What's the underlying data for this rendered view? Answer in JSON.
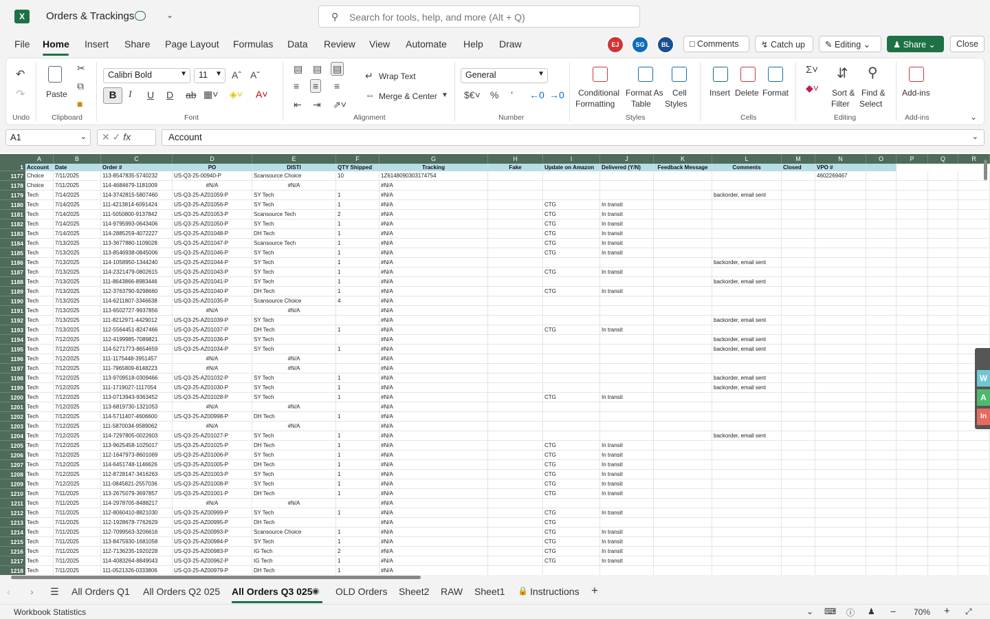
{
  "app": {
    "title": "Orders & Trackings",
    "logo_letter": "X",
    "search_placeholder": "Search for tools, help, and more (Alt + Q)"
  },
  "menu": [
    "File",
    "Home",
    "Insert",
    "Share",
    "Page Layout",
    "Formulas",
    "Data",
    "Review",
    "View",
    "Automate",
    "Help",
    "Draw"
  ],
  "avatars": [
    {
      "initials": "EJ",
      "color": "#d13438"
    },
    {
      "initials": "SG",
      "color": "#0f6cbd"
    },
    {
      "initials": "BL",
      "color": "#1b4f91"
    }
  ],
  "top_buttons": {
    "comments": "Comments",
    "catch_up": "Catch up",
    "editing": "Editing",
    "share": "Share",
    "close": "Close"
  },
  "ribbon": {
    "undo_label": "Undo",
    "paste": "Paste",
    "clipboard": "Clipboard",
    "font_name": "Calibri Bold",
    "font_size": "11",
    "font": "Font",
    "wrap_text": "Wrap Text",
    "merge_center": "Merge & Center",
    "alignment": "Alignment",
    "number_format": "General",
    "number": "Number",
    "cond_format_1": "Conditional",
    "cond_format_2": "Formatting",
    "format_table_1": "Format As",
    "format_table_2": "Table",
    "cell_styles_1": "Cell",
    "cell_styles_2": "Styles",
    "styles": "Styles",
    "insert": "Insert",
    "delete": "Delete",
    "format": "Format",
    "cells": "Cells",
    "sort_1": "Sort &",
    "sort_2": "Filter",
    "find_1": "Find &",
    "find_2": "Select",
    "editing": "Editing",
    "addins_1": "Add-ins",
    "addins_2": "Add-ins"
  },
  "formula_bar": {
    "name_box": "A1",
    "fx": "fx",
    "content": "Account"
  },
  "columns": [
    "A",
    "B",
    "C",
    "D",
    "E",
    "F",
    "G",
    "H",
    "I",
    "J",
    "K",
    "L",
    "M",
    "N",
    "O",
    "P",
    "Q",
    "R"
  ],
  "header_row": {
    "num": "1",
    "cells": [
      "Account",
      "Date",
      "Order #",
      "PO",
      "DISTI",
      "QTY Shipped",
      "Tracking",
      "Fake",
      "Update on Amazon",
      "Delivered (Y/N)",
      "Feedback Message",
      "Comments",
      "Closed",
      "VPO #",
      "",
      "",
      "",
      ""
    ]
  },
  "rows": [
    {
      "n": "1177",
      "a": "Choice",
      "b": "7/11/2025",
      "c": "113-8547835-5740232",
      "d": "US-Q3-25-00940-P",
      "e": "Scansource Choice",
      "f": "10",
      "g": "1Z6148090303174754",
      "i": "",
      "j": "",
      "l": "",
      "nn": "4602269467"
    },
    {
      "n": "1178",
      "a": "Choice",
      "b": "7/11/2025",
      "c": "114-4684679-1181009",
      "d": "#N/A",
      "e": "#N/A",
      "f": "",
      "g": "#N/A",
      "i": "",
      "j": "",
      "l": "",
      "nn": ""
    },
    {
      "n": "1179",
      "a": "Tech",
      "b": "7/14/2025",
      "c": "114-3742815-5807460",
      "d": "US-Q3-25-AZ01059-P",
      "e": "SY Tech",
      "f": "1",
      "g": "#N/A",
      "i": "",
      "j": "",
      "l": "backorder, email sent",
      "nn": ""
    },
    {
      "n": "1180",
      "a": "Tech",
      "b": "7/14/2025",
      "c": "111-4213814-6091424",
      "d": "US-Q3-25-AZ01056-P",
      "e": "SY Tech",
      "f": "1",
      "g": "#N/A",
      "i": "CTG",
      "j": "In transit",
      "l": "",
      "nn": ""
    },
    {
      "n": "1181",
      "a": "Tech",
      "b": "7/14/2025",
      "c": "111-5050800-9137842",
      "d": "US-Q3-25-AZ01053-P",
      "e": "Scansource Tech",
      "f": "2",
      "g": "#N/A",
      "i": "CTG",
      "j": "In transit",
      "l": "",
      "nn": ""
    },
    {
      "n": "1182",
      "a": "Tech",
      "b": "7/14/2025",
      "c": "114-9795993-0643406",
      "d": "US-Q3-25-AZ01050-P",
      "e": "SY Tech",
      "f": "1",
      "g": "#N/A",
      "i": "CTG",
      "j": "In transit",
      "l": "",
      "nn": ""
    },
    {
      "n": "1183",
      "a": "Tech",
      "b": "7/14/2025",
      "c": "114-2885259-4072227",
      "d": "US-Q3-25-AZ01048-P",
      "e": "DH Tech",
      "f": "1",
      "g": "#N/A",
      "i": "CTG",
      "j": "In transit",
      "l": "",
      "nn": ""
    },
    {
      "n": "1184",
      "a": "Tech",
      "b": "7/13/2025",
      "c": "113-3677880-1109028",
      "d": "US-Q3-25-AZ01047-P",
      "e": "Scansource Tech",
      "f": "1",
      "g": "#N/A",
      "i": "CTG",
      "j": "In transit",
      "l": "",
      "nn": ""
    },
    {
      "n": "1185",
      "a": "Tech",
      "b": "7/13/2025",
      "c": "113-8546938-0845006",
      "d": "US-Q3-25-AZ01046-P",
      "e": "SY Tech",
      "f": "1",
      "g": "#N/A",
      "i": "CTG",
      "j": "In transit",
      "l": "",
      "nn": ""
    },
    {
      "n": "1186",
      "a": "Tech",
      "b": "7/13/2025",
      "c": "114-1058950-1344240",
      "d": "US-Q3-25-AZ01044-P",
      "e": "SY Tech",
      "f": "1",
      "g": "#N/A",
      "i": "",
      "j": "",
      "l": "backorder, email sent",
      "nn": ""
    },
    {
      "n": "1187",
      "a": "Tech",
      "b": "7/13/2025",
      "c": "114-2321479-0802615",
      "d": "US-Q3-25-AZ01043-P",
      "e": "SY Tech",
      "f": "1",
      "g": "#N/A",
      "i": "CTG",
      "j": "In transit",
      "l": "",
      "nn": ""
    },
    {
      "n": "1188",
      "a": "Tech",
      "b": "7/13/2025",
      "c": "111-8643866-8983446",
      "d": "US-Q3-25-AZ01041-P",
      "e": "SY Tech",
      "f": "1",
      "g": "#N/A",
      "i": "",
      "j": "",
      "l": "backorder, email sent",
      "nn": ""
    },
    {
      "n": "1189",
      "a": "Tech",
      "b": "7/13/2025",
      "c": "112-3763790-9298660",
      "d": "US-Q3-25-AZ01040-P",
      "e": "DH Tech",
      "f": "1",
      "g": "#N/A",
      "i": "CTG",
      "j": "In transit",
      "l": "",
      "nn": ""
    },
    {
      "n": "1190",
      "a": "Tech",
      "b": "7/13/2025",
      "c": "114-6211807-3346638",
      "d": "US-Q3-25-AZ01035-P",
      "e": "Scansource Choice",
      "f": "4",
      "g": "#N/A",
      "i": "",
      "j": "",
      "l": "",
      "nn": ""
    },
    {
      "n": "1191",
      "a": "Tech",
      "b": "7/13/2025",
      "c": "113-6502727-9937856",
      "d": "#N/A",
      "e": "#N/A",
      "f": "",
      "g": "#N/A",
      "i": "",
      "j": "",
      "l": "",
      "nn": ""
    },
    {
      "n": "1192",
      "a": "Tech",
      "b": "7/13/2025",
      "c": "111-8212971-4429012",
      "d": "US-Q3-25-AZ01039-P",
      "e": "SY Tech",
      "f": "",
      "g": "#N/A",
      "i": "",
      "j": "",
      "l": "backorder, email sent",
      "nn": ""
    },
    {
      "n": "1193",
      "a": "Tech",
      "b": "7/13/2025",
      "c": "112-5564451-8247466",
      "d": "US-Q3-25-AZ01037-P",
      "e": "DH Tech",
      "f": "1",
      "g": "#N/A",
      "i": "CTG",
      "j": "In transit",
      "l": "",
      "nn": ""
    },
    {
      "n": "1194",
      "a": "Tech",
      "b": "7/12/2025",
      "c": "112-4199985-7089821",
      "d": "US-Q3-25-AZ01036-P",
      "e": "SY Tech",
      "f": "",
      "g": "#N/A",
      "i": "",
      "j": "",
      "l": "backorder, email sent",
      "nn": ""
    },
    {
      "n": "1195",
      "a": "Tech",
      "b": "7/12/2025",
      "c": "114-5271773-8654659",
      "d": "US-Q3-25-AZ01034-P",
      "e": "SY Tech",
      "f": "1",
      "g": "#N/A",
      "i": "",
      "j": "",
      "l": "backorder, email sent",
      "nn": ""
    },
    {
      "n": "1196",
      "a": "Tech",
      "b": "7/12/2025",
      "c": "111-1175448-3951457",
      "d": "#N/A",
      "e": "#N/A",
      "f": "",
      "g": "#N/A",
      "i": "",
      "j": "",
      "l": "",
      "nn": ""
    },
    {
      "n": "1197",
      "a": "Tech",
      "b": "7/12/2025",
      "c": "111-7965809-8148223",
      "d": "#N/A",
      "e": "#N/A",
      "f": "",
      "g": "#N/A",
      "i": "",
      "j": "",
      "l": "",
      "nn": ""
    },
    {
      "n": "1198",
      "a": "Tech",
      "b": "7/12/2025",
      "c": "113-9709518-0309466",
      "d": "US-Q3-25-AZ01032-P",
      "e": "SY Tech",
      "f": "1",
      "g": "#N/A",
      "i": "",
      "j": "",
      "l": "backorder, email sent",
      "nn": ""
    },
    {
      "n": "1199",
      "a": "Tech",
      "b": "7/12/2025",
      "c": "111-1719027-1117054",
      "d": "US-Q3-25-AZ01030-P",
      "e": "SY Tech",
      "f": "1",
      "g": "#N/A",
      "i": "",
      "j": "",
      "l": "backorder, email sent",
      "nn": ""
    },
    {
      "n": "1200",
      "a": "Tech",
      "b": "7/12/2025",
      "c": "113-0713943-9363452",
      "d": "US-Q3-25-AZ01028-P",
      "e": "SY Tech",
      "f": "1",
      "g": "#N/A",
      "i": "CTG",
      "j": "In transit",
      "l": "",
      "nn": ""
    },
    {
      "n": "1201",
      "a": "Tech",
      "b": "7/12/2025",
      "c": "113-6819730-1321053",
      "d": "#N/A",
      "e": "#N/A",
      "f": "",
      "g": "#N/A",
      "i": "",
      "j": "",
      "l": "",
      "nn": ""
    },
    {
      "n": "1202",
      "a": "Tech",
      "b": "7/12/2025",
      "c": "114-5711407-4606600",
      "d": "US-Q3-25-AZ00998-P",
      "e": "DH Tech",
      "f": "1",
      "g": "#N/A",
      "i": "",
      "j": "",
      "l": "",
      "nn": ""
    },
    {
      "n": "1203",
      "a": "Tech",
      "b": "7/12/2025",
      "c": "111-5870034-9589062",
      "d": "#N/A",
      "e": "#N/A",
      "f": "",
      "g": "#N/A",
      "i": "",
      "j": "",
      "l": "",
      "nn": ""
    },
    {
      "n": "1204",
      "a": "Tech",
      "b": "7/12/2025",
      "c": "114-7297805-0022603",
      "d": "US-Q3-25-AZ01027-P",
      "e": "SY Tech",
      "f": "1",
      "g": "#N/A",
      "i": "",
      "j": "",
      "l": "backorder, email sent",
      "nn": ""
    },
    {
      "n": "1205",
      "a": "Tech",
      "b": "7/12/2025",
      "c": "113-9625458-1025017",
      "d": "US-Q3-25-AZ01025-P",
      "e": "DH Tech",
      "f": "1",
      "g": "#N/A",
      "i": "CTG",
      "j": "In transit",
      "l": "",
      "nn": ""
    },
    {
      "n": "1206",
      "a": "Tech",
      "b": "7/12/2025",
      "c": "112-1647973-8601069",
      "d": "US-Q3-25-AZ01006-P",
      "e": "SY Tech",
      "f": "1",
      "g": "#N/A",
      "i": "CTG",
      "j": "In transit",
      "l": "",
      "nn": ""
    },
    {
      "n": "1207",
      "a": "Tech",
      "b": "7/12/2025",
      "c": "114-6451748-1146626",
      "d": "US-Q3-25-AZ01005-P",
      "e": "DH Tech",
      "f": "1",
      "g": "#N/A",
      "i": "CTG",
      "j": "In transit",
      "l": "",
      "nn": ""
    },
    {
      "n": "1208",
      "a": "Tech",
      "b": "7/12/2025",
      "c": "112-8728147-3416263",
      "d": "US-Q3-25-AZ01003-P",
      "e": "SY Tech",
      "f": "1",
      "g": "#N/A",
      "i": "CTG",
      "j": "In transit",
      "l": "",
      "nn": ""
    },
    {
      "n": "1209",
      "a": "Tech",
      "b": "7/12/2025",
      "c": "111-0845821-2557036",
      "d": "US-Q3-25-AZ01008-P",
      "e": "SY Tech",
      "f": "1",
      "g": "#N/A",
      "i": "CTG",
      "j": "In transit",
      "l": "",
      "nn": ""
    },
    {
      "n": "1210",
      "a": "Tech",
      "b": "7/11/2025",
      "c": "113-2675079-3697857",
      "d": "US-Q3-25-AZ01001-P",
      "e": "DH Tech",
      "f": "1",
      "g": "#N/A",
      "i": "CTG",
      "j": "In transit",
      "l": "",
      "nn": ""
    },
    {
      "n": "1211",
      "a": "Tech",
      "b": "7/11/2025",
      "c": "114-2978705-8488217",
      "d": "#N/A",
      "e": "#N/A",
      "f": "",
      "g": "#N/A",
      "i": "",
      "j": "",
      "l": "",
      "nn": ""
    },
    {
      "n": "1212",
      "a": "Tech",
      "b": "7/11/2025",
      "c": "112-8060410-8821030",
      "d": "US-Q3-25-AZ00999-P",
      "e": "SY Tech",
      "f": "1",
      "g": "#N/A",
      "i": "CTG",
      "j": "In transit",
      "l": "",
      "nn": ""
    },
    {
      "n": "1213",
      "a": "Tech",
      "b": "7/11/2025",
      "c": "112-1928678-7762629",
      "d": "US-Q3-25-AZ00995-P",
      "e": "DH Tech",
      "f": "",
      "g": "#N/A",
      "i": "CTG",
      "j": "",
      "l": "",
      "nn": ""
    },
    {
      "n": "1214",
      "a": "Tech",
      "b": "7/11/2025",
      "c": "112-7099563-3206616",
      "d": "US-Q3-25-AZ00993-P",
      "e": "Scansource Choice",
      "f": "1",
      "g": "#N/A",
      "i": "CTG",
      "j": "In transit",
      "l": "",
      "nn": ""
    },
    {
      "n": "1215",
      "a": "Tech",
      "b": "7/11/2025",
      "c": "113-8475930-1681058",
      "d": "US-Q3-25-AZ00984-P",
      "e": "SY Tech",
      "f": "1",
      "g": "#N/A",
      "i": "CTG",
      "j": "In transit",
      "l": "",
      "nn": ""
    },
    {
      "n": "1216",
      "a": "Tech",
      "b": "7/11/2025",
      "c": "112-7136235-1920228",
      "d": "US-Q3-25-AZ00983-P",
      "e": "IG Tech",
      "f": "2",
      "g": "#N/A",
      "i": "CTG",
      "j": "In transit",
      "l": "",
      "nn": ""
    },
    {
      "n": "1217",
      "a": "Tech",
      "b": "7/11/2025",
      "c": "114-4083264-8849043",
      "d": "US-Q3-25-AZ00962-P",
      "e": "IG Tech",
      "f": "1",
      "g": "#N/A",
      "i": "CTG",
      "j": "In transit",
      "l": "",
      "nn": ""
    },
    {
      "n": "1218",
      "a": "Tech",
      "b": "7/11/2025",
      "c": "111-0521326-0333806",
      "d": "US-Q3-25-AZ00979-P",
      "e": "DH Tech",
      "f": "1",
      "g": "#N/A",
      "i": "",
      "j": "",
      "l": "",
      "nn": ""
    }
  ],
  "sheet_tabs": [
    "All Orders Q1",
    "All Orders Q2 025",
    "All Orders Q3 025",
    "OLD Orders",
    "Sheet2",
    "RAW",
    "Sheet1",
    "Instructions"
  ],
  "status": {
    "left": "Workbook Statistics",
    "zoom": "70%"
  },
  "side_panel": [
    "W",
    "A",
    "In"
  ]
}
